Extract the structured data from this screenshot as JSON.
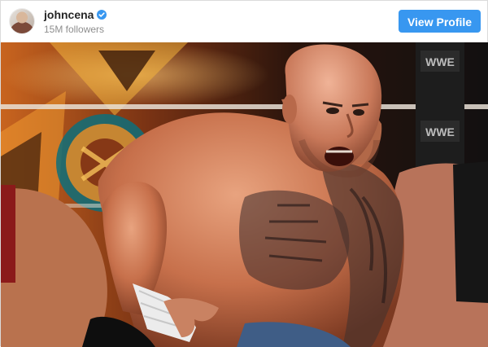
{
  "header": {
    "username": "johncena",
    "followers": "15M followers",
    "view_profile_label": "View Profile",
    "verified_icon": "verified-badge-icon"
  },
  "colors": {
    "accent": "#3897f0",
    "username": "#262626",
    "followers": "#8e8e8e"
  },
  "photo": {
    "watermark_text": "WWE"
  }
}
